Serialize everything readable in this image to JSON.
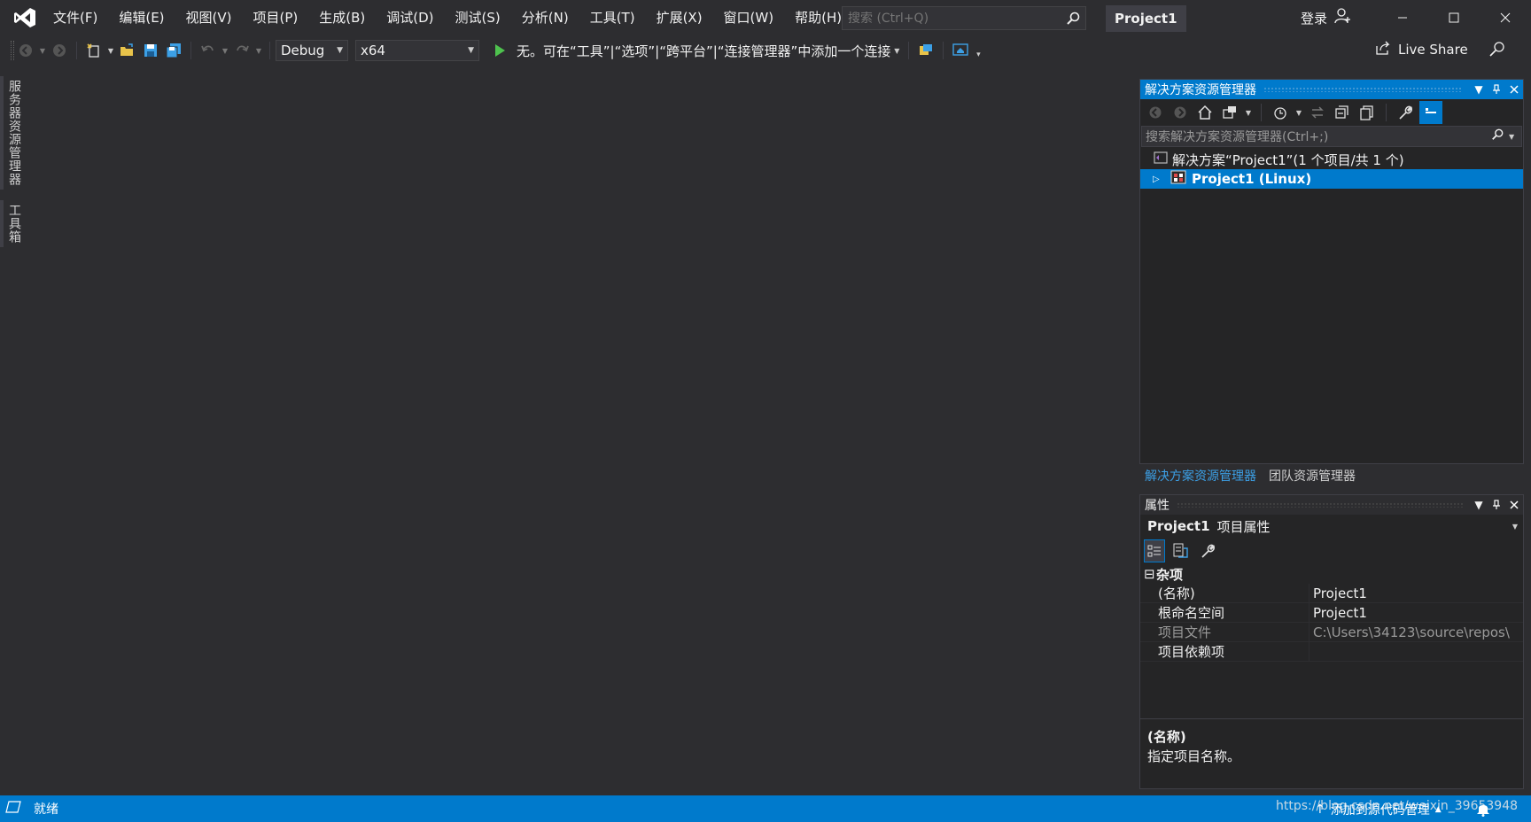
{
  "menu": {
    "items": [
      "文件(F)",
      "编辑(E)",
      "视图(V)",
      "项目(P)",
      "生成(B)",
      "调试(D)",
      "测试(S)",
      "分析(N)",
      "工具(T)",
      "扩展(X)",
      "窗口(W)",
      "帮助(H)"
    ]
  },
  "search": {
    "placeholder": "搜索 (Ctrl+Q)"
  },
  "title": {
    "project": "Project1"
  },
  "account": {
    "login": "登录"
  },
  "toolbar": {
    "config": "Debug",
    "platform": "x64",
    "run_target": "无。可在“工具”|“选项”|“跨平台”|“连接管理器”中添加一个连接",
    "live_share": "Live Share"
  },
  "side_tabs": [
    "服务器资源管理器",
    "工具箱"
  ],
  "solution_explorer": {
    "title": "解决方案资源管理器",
    "search_placeholder": "搜索解决方案资源管理器(Ctrl+;)",
    "solution_label": "解决方案“Project1”(1 个项目/共 1 个)",
    "project_label": "Project1 (Linux)",
    "tabs": [
      "解决方案资源管理器",
      "团队资源管理器"
    ]
  },
  "properties": {
    "title": "属性",
    "object_name": "Project1",
    "object_type": "项目属性",
    "category": "杂项",
    "rows": [
      {
        "name": "(名称)",
        "value": "Project1"
      },
      {
        "name": "根命名空间",
        "value": "Project1"
      },
      {
        "name": "项目文件",
        "value": "C:\\Users\\34123\\source\\repos\\"
      },
      {
        "name": "项目依赖项",
        "value": ""
      }
    ],
    "desc_title": "(名称)",
    "desc_text": "指定项目名称。"
  },
  "status": {
    "text": "就绪",
    "source_control": "添加到源代码管理",
    "watermark": "https://blog.csdn.net/weixin_39653948"
  },
  "colors": {
    "accent": "#007acc",
    "background": "#2d2d30",
    "panel": "#252526"
  }
}
